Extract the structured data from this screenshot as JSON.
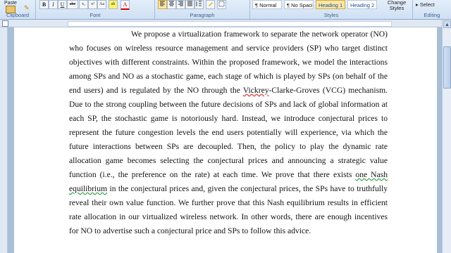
{
  "ribbon": {
    "clipboard": {
      "paste_label": "Paste",
      "group_label": "Clipboard"
    },
    "font": {
      "group_label": "Font",
      "bold": "B",
      "italic": "I",
      "underline": "U",
      "strike": "abe",
      "subscript": "x₂",
      "superscript": "x²",
      "change_case": "Aa",
      "highlight": "ab",
      "font_color": "A"
    },
    "paragraph": {
      "group_label": "Paragraph"
    },
    "styles": {
      "group_label": "Styles",
      "items": [
        "¶ Normal",
        "¶ No Spaci...",
        "Heading 1",
        "Heading 2"
      ],
      "change_styles": "Change Styles"
    },
    "editing": {
      "select_label": "Select",
      "group_label": "Editing"
    }
  },
  "document": {
    "paragraph": [
      "We propose a virtualization framework to separate the network operator (NO) who focuses on wireless resource management and service providers (SP) who target distinct objectives with different constraints. Within the proposed framework, we model the interactions among SPs and NO as a stochastic game, each stage of which is played by SPs (on behalf of the end users) and is regulated by the NO through the ",
      "Vickrey",
      "-Clarke-Groves (VCG) mechanism. Due to the strong coupling between the future decisions of SPs and lack of global information at each SP, the stochastic game is notoriously hard. Instead, we introduce conjectural prices to represent the future congestion levels the end users potentially will experience, via which the future interactions between SPs are decoupled. Then, the policy to play the dynamic rate allocation game becomes selecting the conjectural prices and announcing a strategic value function (i.e., the preference on the rate) at each time. We prove that there exists ",
      "one Nash equilibrium",
      " in the conjectural prices and, given the conjectural prices, the SPs have to truthfully reveal their own value function. We further prove that this Nash equilibrium results in efficient rate allocation in our virtualized wireless network. In other words, there are enough incentives for NO to advertise such a conjectural price and SPs to follow this advice."
    ]
  },
  "colors": {
    "ribbon_bg": "#cfe0f3",
    "active_style": "#fbe7a6",
    "spell_error": "#e23030",
    "grammar_error": "#3aa04a"
  }
}
